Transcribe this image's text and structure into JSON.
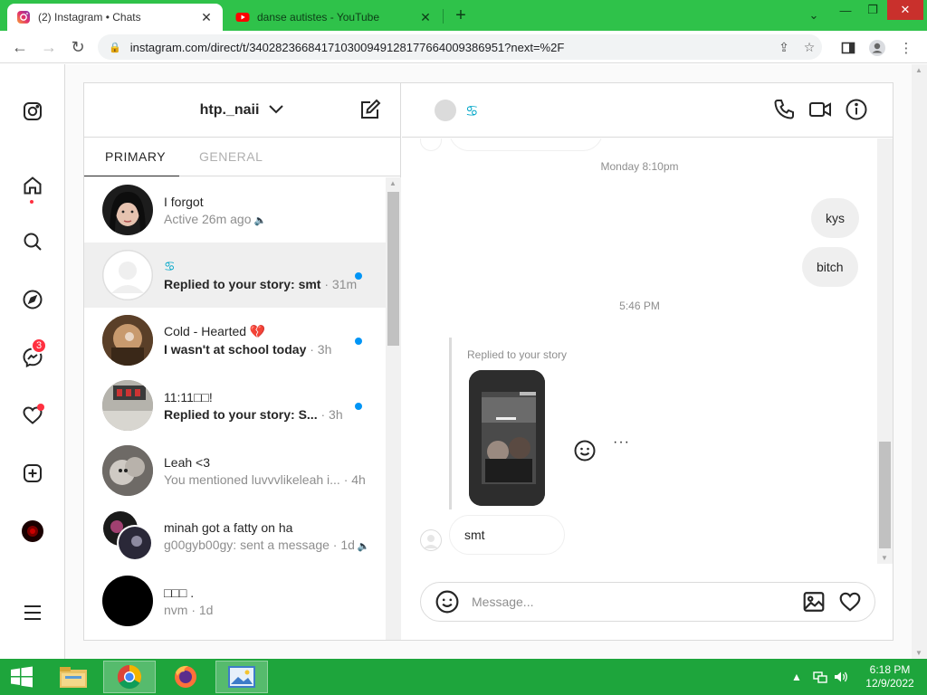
{
  "browser": {
    "tabs": [
      {
        "title": "(2) Instagram • Chats",
        "active": true,
        "favicon": "instagram-icon"
      },
      {
        "title": "danse autistes - YouTube",
        "active": false,
        "favicon": "youtube-icon"
      }
    ],
    "close_glyph": "✕",
    "new_tab_glyph": "+",
    "window_controls": {
      "chevron": "⌄",
      "minimize": "—",
      "maximize": "❐",
      "close": "✕"
    },
    "url": "instagram.com/direct/t/340282366841710300949128177664009386951?next=%2F",
    "colors": {
      "tab_strip": "#2fc24a",
      "close_button": "#c9302c"
    }
  },
  "sidebar": {
    "items": [
      "instagram-logo-icon",
      "home-icon",
      "search-icon",
      "explore-icon",
      "messenger-icon",
      "heart-icon",
      "create-icon",
      "profile-avatar",
      "menu-icon"
    ],
    "messages_badge": "3"
  },
  "inbox": {
    "username": "htp._naii",
    "tabs": {
      "primary": "PRIMARY",
      "general": "GENERAL"
    },
    "threads": [
      {
        "name": "I forgot",
        "sub": "Active 26m ago",
        "time": "",
        "unread": false,
        "muted": true
      },
      {
        "name": "♋",
        "sub": "Replied to your story: smt",
        "time": " · 31m",
        "unread": true,
        "muted": false
      },
      {
        "name": "Cold - Hearted 💔",
        "sub": "I wasn't at school today",
        "time": " · 3h",
        "unread": true,
        "muted": false
      },
      {
        "name": "11:11□□!",
        "sub": "Replied to your story: S...",
        "time": " · 3h",
        "unread": true,
        "muted": false
      },
      {
        "name": "Leah <3",
        "sub": "You mentioned luvvvlikeleah i...",
        "time": " · 4h",
        "unread": false,
        "muted": false
      },
      {
        "name": "minah got a fatty on ha",
        "sub": "g00gyb00gy: sent a message",
        "time": " · 1d",
        "unread": false,
        "muted": true
      },
      {
        "name": "□□□ .",
        "sub": "nvm",
        "time": " · 1d",
        "unread": false,
        "muted": false
      }
    ],
    "mute_glyph": "🔈"
  },
  "chat": {
    "contact_name": "♋",
    "timestamps": [
      "Monday 8:10pm",
      "5:46 PM"
    ],
    "outgoing": [
      "kys",
      "bitch"
    ],
    "story_reply_label": "Replied to your story",
    "incoming": "smt",
    "more_glyph": "···",
    "composer_placeholder": "Message..."
  },
  "taskbar": {
    "time": "6:18 PM",
    "date": "12/9/2022",
    "tray_up": "▲"
  },
  "colors": {
    "taskbar": "#1ea53c",
    "unread_dot": "#0095f6",
    "badge": "#ff3040",
    "chat_title": "#00a6c8"
  }
}
